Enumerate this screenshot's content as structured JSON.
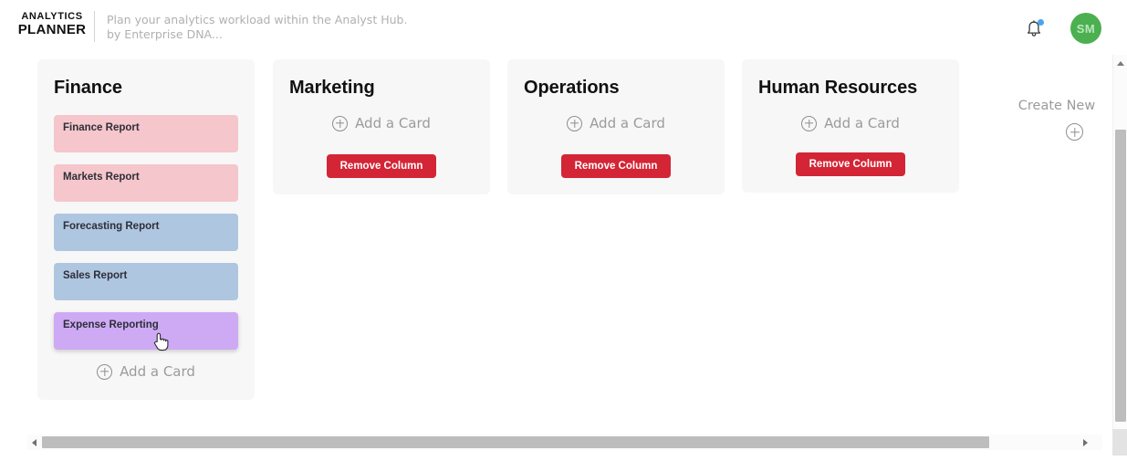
{
  "header": {
    "logo_top": "ANALYTICS",
    "logo_bottom": "PLANNER",
    "tagline_line1": "Plan your analytics workload within the Analyst Hub.",
    "tagline_line2": "by Enterprise DNA...",
    "notification_icon": "bell-icon",
    "notification_dot_color": "#4aa3f0",
    "avatar_initials": "SM",
    "avatar_color": "#4caf50"
  },
  "board": {
    "add_card_label": "Add a Card",
    "remove_column_label": "Remove Column",
    "remove_button_color": "#d32535",
    "columns": [
      {
        "title": "Finance",
        "has_remove_button": false,
        "cards": [
          {
            "label": "Finance Report",
            "color": "#f5c6cb"
          },
          {
            "label": "Markets Report",
            "color": "#f5c6cb"
          },
          {
            "label": "Forecasting Report",
            "color": "#aec6e0"
          },
          {
            "label": "Sales Report",
            "color": "#aec6e0"
          },
          {
            "label": "Expense Reporting",
            "color": "#ceaaf5"
          }
        ]
      },
      {
        "title": "Marketing",
        "has_remove_button": true,
        "cards": []
      },
      {
        "title": "Operations",
        "has_remove_button": true,
        "cards": []
      },
      {
        "title": "Human Resources",
        "has_remove_button": true,
        "cards": []
      }
    ]
  },
  "create_new": {
    "label": "Create New",
    "icon": "plus-circle-icon"
  },
  "scrollbars": {
    "vertical_visible": true,
    "horizontal_visible": true
  }
}
